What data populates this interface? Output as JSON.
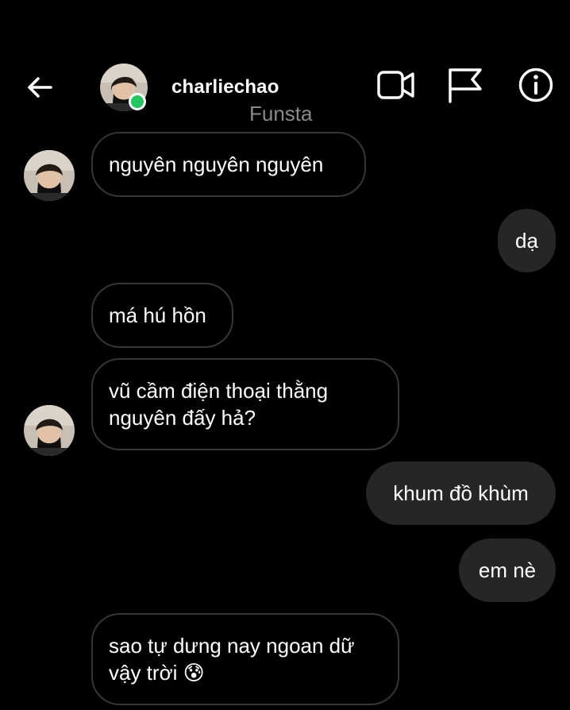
{
  "header": {
    "back_icon": "arrow-left-icon",
    "username": "charliechao",
    "online": true,
    "online_color": "#22c55e",
    "watermark": "Funsta",
    "icons": [
      "video-call-icon",
      "flag-icon",
      "info-icon"
    ]
  },
  "messages": [
    {
      "side": "in",
      "text": "nguyên nguyên nguyên",
      "avatar": true
    },
    {
      "side": "out",
      "text": "dạ"
    },
    {
      "side": "in",
      "text": "má hú hồn",
      "avatar": false
    },
    {
      "side": "in",
      "text": "vũ cầm điện thoại thằng\nnguyên đấy hả?",
      "avatar": true
    },
    {
      "side": "out",
      "text": "khum đồ khùm"
    },
    {
      "side": "out",
      "text": "em nè"
    },
    {
      "side": "in",
      "text": "sao tự dưng nay ngoan dữ\nvậy trời 😰",
      "avatar": false
    }
  ],
  "colors": {
    "background": "#000000",
    "outgoing_bubble": "#262626",
    "incoming_border": "#363636",
    "watermark": "#8a8a8a"
  }
}
